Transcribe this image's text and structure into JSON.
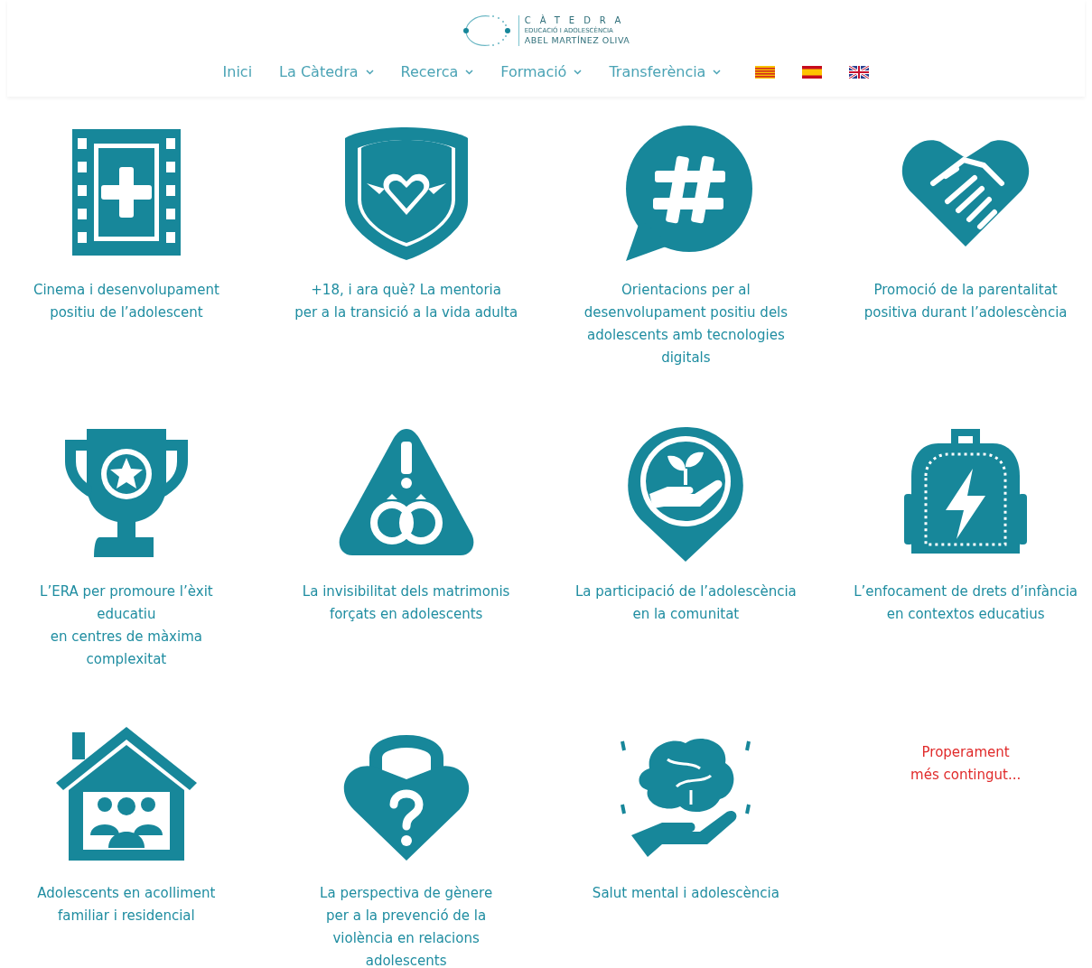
{
  "logo": {
    "title": "CÀTEDRA",
    "subtitle": "EDUCACIÓ I ADOLESCÈNCIA",
    "name": "ABEL MARTÍNEZ OLIVA"
  },
  "nav": [
    {
      "label": "Inici",
      "dropdown": false
    },
    {
      "label": "La Càtedra",
      "dropdown": true
    },
    {
      "label": "Recerca",
      "dropdown": true
    },
    {
      "label": "Formació",
      "dropdown": true
    },
    {
      "label": "Transferència",
      "dropdown": true
    }
  ],
  "languages": [
    {
      "kind": "catalan"
    },
    {
      "kind": "spanish"
    },
    {
      "kind": "english"
    }
  ],
  "cards": [
    {
      "kind": "project",
      "title": "Cinema i desenvolupament\npositiu de l’adolescent"
    },
    {
      "kind": "project",
      "title": "+18, i ara què? La mentoria\nper a la transició a la vida adulta"
    },
    {
      "kind": "project",
      "title": "Orientacions per al\ndesenvolupament positiu dels\nadolescents amb tecnologies\ndigitals"
    },
    {
      "kind": "project",
      "title": "Promoció de la parentalitat\npositiva durant l’adolescència"
    },
    {
      "kind": "project",
      "title": "L’ERA per promoure l’èxit\neducatiu\nen centres de màxima\ncomplexitat"
    },
    {
      "kind": "project",
      "title": "La invisibilitat dels matrimonis\nforçats en adolescents"
    },
    {
      "kind": "project",
      "title": "La participació de l’adolescència\nen la comunitat"
    },
    {
      "kind": "project",
      "title": "L’enfocament de drets d’infància\nen contextos educatius"
    },
    {
      "kind": "project",
      "title": "Adolescents en acolliment\nfamiliar i residencial"
    },
    {
      "kind": "project",
      "title": "La perspectiva de gènere\nper a la prevenció de la\nviolència en relacions\nadolescents"
    },
    {
      "kind": "project",
      "title": "Salut mental i adolescència"
    },
    {
      "kind": "note",
      "title": "Properament\nmés contingut..."
    }
  ]
}
